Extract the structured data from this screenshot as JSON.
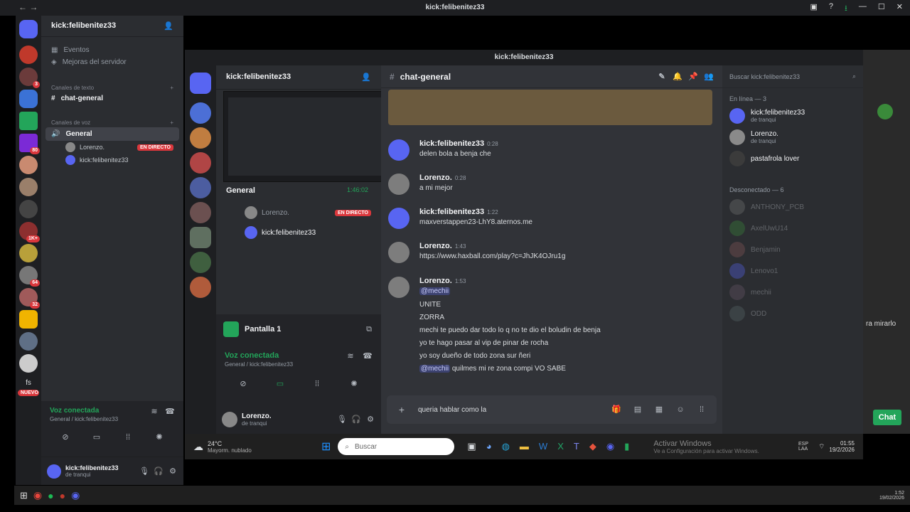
{
  "window": {
    "title": "kick:felibenitez33"
  },
  "outer": {
    "server_name": "kick:felibenitez33",
    "top_items": [
      {
        "label": "Eventos"
      },
      {
        "label": "Mejoras del servidor"
      }
    ],
    "text_category": "Canales de texto",
    "text_channel": "chat-general",
    "voice_category": "Canales de voz",
    "voice_channel": "General",
    "voice_members": [
      {
        "name": "Lorenzo.",
        "live": "EN DIRECTO"
      },
      {
        "name": "kick:felibenitez33"
      }
    ],
    "voice_connected": "Voz conectada",
    "voice_sub": "General / kick:felibenitez33",
    "user_name": "kick:felibenitez33",
    "user_status": "de tranqui",
    "guild_badges": [
      "3",
      "80",
      "1K+",
      "64",
      "32"
    ],
    "fs_label": "fs",
    "new_badge": "NUEVO"
  },
  "mirror": {
    "title": "kick:felibenitez33",
    "server_name": "kick:felibenitez33",
    "preview_channel": "General",
    "preview_time": "1:46:02",
    "voice_members": [
      {
        "name": "Lorenzo.",
        "live": "EN DIRECTO"
      },
      {
        "name": "kick:felibenitez33"
      }
    ],
    "screen_label": "Pantalla 1",
    "voice_connected": "Voz conectada",
    "voice_sub": "General / kick:felibenitez33",
    "user_name": "Lorenzo.",
    "user_status": "de tranqui"
  },
  "chat": {
    "channel": "chat-general",
    "messages": [
      {
        "author": "kick:felibenitez33",
        "time": "0:28",
        "lines": [
          "delen bola a benja che"
        ]
      },
      {
        "author": "Lorenzo.",
        "time": "0:28",
        "lines": [
          "a mi mejor"
        ]
      },
      {
        "author": "kick:felibenitez33",
        "time": "1:22",
        "lines": [
          "maxverstappen23-LhY8.aternos.me"
        ]
      },
      {
        "author": "Lorenzo.",
        "time": "1:43",
        "lines": [
          "https://www.haxball.com/play?c=JhJK4OJru1g"
        ]
      },
      {
        "author": "Lorenzo.",
        "time": "1:53",
        "lines": [
          "@mechii",
          "UNITE",
          "ZORRA",
          "mechi te puedo dar todo lo q no te dio el boludin de benja",
          "yo te hago pasar al vip de pinar de rocha",
          "yo soy dueño de todo zona sur ñeri"
        ]
      }
    ],
    "last_mention": "@mechii",
    "last_text": "quilmes mi re zona compi VO SABE",
    "input_value": "queria hablar como la"
  },
  "members": {
    "search_placeholder": "Buscar kick:felibenitez33",
    "online_header": "En línea — 3",
    "online": [
      {
        "name": "kick:felibenitez33",
        "status": "de tranqui"
      },
      {
        "name": "Lorenzo.",
        "status": "de tranqui"
      },
      {
        "name": "pastafrola lover",
        "status": ""
      }
    ],
    "offline_header": "Desconectado — 6",
    "offline": [
      {
        "name": "ANTHONY_PCB"
      },
      {
        "name": "AxelUwU14"
      },
      {
        "name": "Benjamin"
      },
      {
        "name": "Lenovo1"
      },
      {
        "name": "mechii"
      },
      {
        "name": "ODD"
      }
    ]
  },
  "taskbar": {
    "weather": "24°C",
    "weather_desc": "Mayorm. nublado",
    "search": "Buscar",
    "activate": "Activar Windows",
    "activate_sub": "Ve a Configuración para activar Windows.",
    "lang": "ESP LAA",
    "time": "01:55",
    "date": "19/2/2026"
  },
  "right": {
    "snippet": "ra mirarlo",
    "chat_button": "Chat"
  },
  "bottom": {
    "time": "1:52",
    "date": "19/02/2026"
  }
}
